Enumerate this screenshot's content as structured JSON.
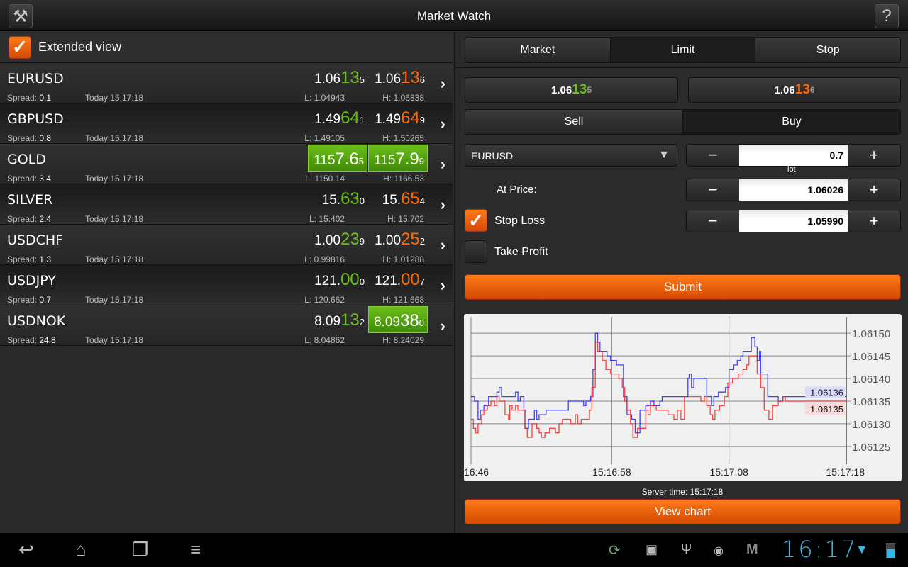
{
  "header": {
    "title": "Market Watch",
    "tools_icon": "wrench-screwdriver-icon",
    "help_label": "?"
  },
  "extended_view": {
    "label": "Extended view",
    "checked": true
  },
  "quotes": [
    {
      "symbol": "EURUSD",
      "spread_label": "Spread:",
      "spread": "0.1",
      "time": "Today 15:17:18",
      "bid": {
        "p": "1.06",
        "b": "13",
        "s": "5",
        "hl": false
      },
      "ask": {
        "p": "1.06",
        "b": "13",
        "s": "6",
        "hl": false
      },
      "low": "L: 1.04943",
      "high": "H: 1.06838"
    },
    {
      "symbol": "GBPUSD",
      "spread_label": "Spread:",
      "spread": "0.8",
      "time": "Today 15:17:18",
      "bid": {
        "p": "1.49",
        "b": "64",
        "s": "1",
        "hl": false
      },
      "ask": {
        "p": "1.49",
        "b": "64",
        "s": "9",
        "hl": false
      },
      "low": "L: 1.49105",
      "high": "H: 1.50265"
    },
    {
      "symbol": "GOLD",
      "spread_label": "Spread:",
      "spread": "3.4",
      "time": "Today 15:17:18",
      "bid": {
        "p": "115",
        "b": "7.6",
        "s": "5",
        "hl": true
      },
      "ask": {
        "p": "115",
        "b": "7.9",
        "s": "9",
        "hl": true
      },
      "low": "L: 1150.14",
      "high": "H: 1166.53"
    },
    {
      "symbol": "SILVER",
      "spread_label": "Spread:",
      "spread": "2.4",
      "time": "Today 15:17:18",
      "bid": {
        "p": "15.",
        "b": "63",
        "s": "0",
        "hl": false
      },
      "ask": {
        "p": "15.",
        "b": "65",
        "s": "4",
        "hl": false
      },
      "low": "L: 15.402",
      "high": "H: 15.702"
    },
    {
      "symbol": "USDCHF",
      "spread_label": "Spread:",
      "spread": "1.3",
      "time": "Today 15:17:18",
      "bid": {
        "p": "1.00",
        "b": "23",
        "s": "9",
        "hl": false
      },
      "ask": {
        "p": "1.00",
        "b": "25",
        "s": "2",
        "hl": false
      },
      "low": "L: 0.99816",
      "high": "H: 1.01288"
    },
    {
      "symbol": "USDJPY",
      "spread_label": "Spread:",
      "spread": "0.7",
      "time": "Today 15:17:18",
      "bid": {
        "p": "121.",
        "b": "00",
        "s": "0",
        "hl": false
      },
      "ask": {
        "p": "121.",
        "b": "00",
        "s": "7",
        "hl": false
      },
      "low": "L: 120.662",
      "high": "H: 121.668"
    },
    {
      "symbol": "USDNOK",
      "spread_label": "Spread:",
      "spread": "24.8",
      "time": "Today 15:17:18",
      "bid": {
        "p": "8.09",
        "b": "13",
        "s": "2",
        "hl": false
      },
      "ask": {
        "p": "8.09",
        "b": "38",
        "s": "0",
        "hl": true
      },
      "low": "L: 8.04862",
      "high": "H: 8.24029"
    }
  ],
  "order": {
    "tabs": [
      "Market",
      "Limit",
      "Stop"
    ],
    "active_tab": "Limit",
    "sell_price": {
      "p": "1.06",
      "b": "13",
      "s": "5"
    },
    "buy_price": {
      "p": "1.06",
      "b": "13",
      "s": "6"
    },
    "sides": [
      "Sell",
      "Buy"
    ],
    "active_side": "Buy",
    "symbol": "EURUSD",
    "lot": "0.7",
    "lot_label": "lot",
    "at_price_label": "At Price:",
    "at_price": "1.06026",
    "stop_loss_label": "Stop Loss",
    "stop_loss_checked": true,
    "stop_loss": "1.05990",
    "take_profit_label": "Take Profit",
    "take_profit_checked": false,
    "minus": "−",
    "plus": "+",
    "submit_label": "Submit",
    "server_time": "Server time: 15:17:18",
    "view_chart_label": "View chart"
  },
  "chart_data": {
    "type": "line",
    "ylim": [
      1.06122,
      1.06153
    ],
    "xlim_seconds": [
      0,
      32
    ],
    "x_ticks": [
      {
        "t": 0,
        "label": "16:46"
      },
      {
        "t": 12,
        "label": "15:16:58"
      },
      {
        "t": 22,
        "label": "15:17:08"
      },
      {
        "t": 32,
        "label": "15:17:18"
      }
    ],
    "y_ticks": [
      "1.06150",
      "1.06145",
      "1.06140",
      "1.06135",
      "1.06130",
      "1.06125"
    ],
    "series": [
      {
        "name": "ask",
        "color": "#2222ff",
        "last_label": "1.06136",
        "t": [
          0,
          0.3,
          0.6,
          0.8,
          1.1,
          1.5,
          2.2,
          2.4,
          2.6,
          3.8,
          4.0,
          4.2,
          4.5,
          4.6,
          4.9,
          5.4,
          5.6,
          5.8,
          6.4,
          8.3,
          9.6,
          9.8,
          10.2,
          10.4,
          10.6,
          10.8,
          11.0,
          11.6,
          11.9,
          12.4,
          13.0,
          13.3,
          13.7,
          14.0,
          14.4,
          14.9,
          15.3,
          15.6,
          16.1,
          16.3,
          18.5,
          18.6,
          18.8,
          19.0,
          20.1,
          20.5,
          20.7,
          21.1,
          21.7,
          22.0,
          22.4,
          22.7,
          23.0,
          23.2,
          23.9,
          24.2,
          24.4,
          24.6,
          24.7,
          25.3,
          26.2,
          26.6,
          32
        ],
        "v": [
          1.06136,
          1.06135,
          1.06131,
          1.06133,
          1.06134,
          1.06136,
          1.06137,
          1.06138,
          1.06136,
          1.06137,
          1.06135,
          1.06136,
          1.06133,
          1.06129,
          1.06131,
          1.06133,
          1.06131,
          1.06132,
          1.06133,
          1.06135,
          1.06134,
          1.06135,
          1.06136,
          1.06142,
          1.0615,
          1.06148,
          1.06146,
          1.06145,
          1.06144,
          1.06143,
          1.06136,
          1.06132,
          1.06131,
          1.06128,
          1.06133,
          1.06134,
          1.06135,
          1.06134,
          1.06135,
          1.06136,
          1.0614,
          1.06141,
          1.06138,
          1.0614,
          1.06136,
          1.06134,
          1.06136,
          1.06137,
          1.06138,
          1.06142,
          1.06143,
          1.06144,
          1.06145,
          1.06146,
          1.06149,
          1.06147,
          1.06144,
          1.06146,
          1.06141,
          1.06136,
          1.06135,
          1.06136,
          1.06136
        ]
      },
      {
        "name": "bid",
        "color": "#ff2222",
        "last_label": "1.06135",
        "t": [
          0,
          0.2,
          0.4,
          0.6,
          0.9,
          1.1,
          1.4,
          1.7,
          2.0,
          2.2,
          2.4,
          2.9,
          3.2,
          3.3,
          3.5,
          3.8,
          4.0,
          4.6,
          4.8,
          5.2,
          5.6,
          5.8,
          6.0,
          6.3,
          6.7,
          7.2,
          7.5,
          7.8,
          8.5,
          8.9,
          9.1,
          9.4,
          10.1,
          10.3,
          10.6,
          10.8,
          11.2,
          11.5,
          11.9,
          12.6,
          12.9,
          13.1,
          13.3,
          13.6,
          13.8,
          14.2,
          14.9,
          15.1,
          15.3,
          15.8,
          16.8,
          17.3,
          17.6,
          17.9,
          18.2,
          18.7,
          19.6,
          19.9,
          20.1,
          20.4,
          20.6,
          20.8,
          21.2,
          21.6,
          21.9,
          22.3,
          22.8,
          23.2,
          23.5,
          23.7,
          24.2,
          24.4,
          24.7,
          25.0,
          25.4,
          25.7,
          26.2,
          26.6,
          26.8,
          32
        ],
        "v": [
          1.06131,
          1.06129,
          1.06128,
          1.0613,
          1.06132,
          1.06133,
          1.06134,
          1.06135,
          1.06134,
          1.06136,
          1.06135,
          1.06132,
          1.06131,
          1.06134,
          1.06133,
          1.06134,
          1.06133,
          1.06129,
          1.06127,
          1.0613,
          1.06129,
          1.06128,
          1.06127,
          1.06128,
          1.06129,
          1.06128,
          1.0613,
          1.06131,
          1.0613,
          1.06132,
          1.0613,
          1.06131,
          1.06133,
          1.06138,
          1.06148,
          1.06146,
          1.06144,
          1.06142,
          1.06141,
          1.0614,
          1.06138,
          1.06135,
          1.06133,
          1.0613,
          1.06127,
          1.06129,
          1.06133,
          1.06132,
          1.06134,
          1.06133,
          1.06132,
          1.06131,
          1.06133,
          1.06131,
          1.06136,
          1.06136,
          1.06135,
          1.06136,
          1.06134,
          1.06132,
          1.06131,
          1.06133,
          1.06134,
          1.06136,
          1.06139,
          1.0614,
          1.06141,
          1.06142,
          1.06143,
          1.06145,
          1.06145,
          1.06141,
          1.06138,
          1.06133,
          1.06131,
          1.06134,
          1.06135,
          1.06136,
          1.06135,
          1.06135
        ]
      }
    ]
  },
  "statusbar": {
    "clock": "16:17"
  }
}
